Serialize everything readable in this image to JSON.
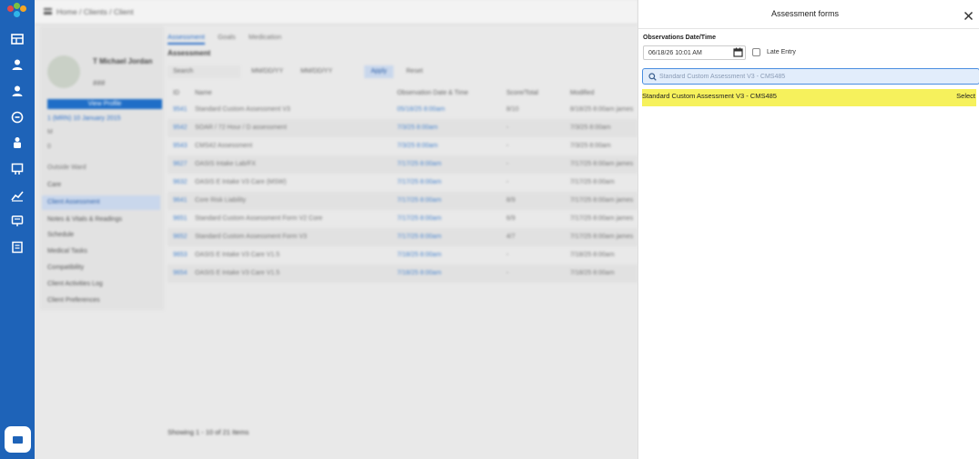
{
  "background_app": {
    "breadcrumb": "Home / Clients / Client",
    "client_name": "T Michael Jordan",
    "client_id": "###",
    "view_button_label": "View Profile",
    "side_link": "1 (MRN) 10 January 2015",
    "side_small_1": "M",
    "side_small_2": "0",
    "side_section": "Outside Ward",
    "menu": [
      "Care",
      "Client Assessment",
      "Notes & Vitals & Readings",
      "Schedule",
      "Medical Tasks",
      "Compatibility",
      "Client Activities Log",
      "Client Preferences"
    ],
    "tabs": [
      "Assessment",
      "Goals",
      "Medication"
    ],
    "section_title": "Assessment",
    "filters": [
      "Search",
      "MM/DD/YY",
      "MM/DD/YY",
      "Apply",
      "Reset"
    ],
    "table_headers": [
      "ID",
      "Name",
      "Observation Date & Time",
      "Score/Total",
      "Modified"
    ],
    "rows": [
      [
        "9541",
        "Standard Custom Assessment V3",
        "05/18/25 8:00am",
        "8/10",
        "8/18/25 8:00am james"
      ],
      [
        "9542",
        "SOAR / 72 Hour / D assessment",
        "7/3/25 8:00am",
        "-",
        "7/3/25 8:00am"
      ],
      [
        "9543",
        "CMS42 Assessment",
        "7/3/25 8:00am",
        "-",
        "7/3/25 8:00am"
      ],
      [
        "9627",
        "OASIS Intake Lab/FX",
        "7/17/25 8:00am",
        "-",
        "7/17/25 8:00am james"
      ],
      [
        "9632",
        "OASIS E Intake V3 Care (MSW)",
        "7/17/25 8:00am",
        "-",
        "7/17/25 8:00am"
      ],
      [
        "9641",
        "Core Risk Liability",
        "7/17/25 8:00am",
        "8/9",
        "7/17/25 8:00am james"
      ],
      [
        "9651",
        "Standard Custom Assessment Form V2 Core",
        "7/17/25 8:00am",
        "6/9",
        "7/17/25 8:00am james"
      ],
      [
        "9652",
        "Standard Custom Assessment Form V3",
        "7/17/25 8:00am",
        "4/7",
        "7/17/25 8:00am james"
      ],
      [
        "9653",
        "OASIS E Intake V3 Care V1.5",
        "7/18/25 8:00am",
        "-",
        "7/18/25 8:00am"
      ],
      [
        "9654",
        "OASIS E Intake V3 Care V1.5",
        "7/18/25 8:00am",
        "-",
        "7/18/25 8:00am"
      ]
    ],
    "footer_count": "Showing 1 - 10 of 21 Items"
  },
  "panel": {
    "title": "Assessment forms",
    "observations_label": "Observations Date/Time",
    "date_value": "06/18/26 10:01 AM",
    "late_entry_label": "Late Entry",
    "search_value": "Standard Custom Assessment V3 - CMS485",
    "result_name": "Standard Custom Assessment V3 - CMS485",
    "result_action": "Select"
  },
  "colors": {
    "rail": "#1e63b8",
    "highlight": "#f6f15c",
    "search_bg": "#e2edfb",
    "search_border": "#4a8ee0"
  },
  "icons": {
    "close": "close-icon",
    "calendar": "calendar-icon",
    "search": "search-icon"
  }
}
